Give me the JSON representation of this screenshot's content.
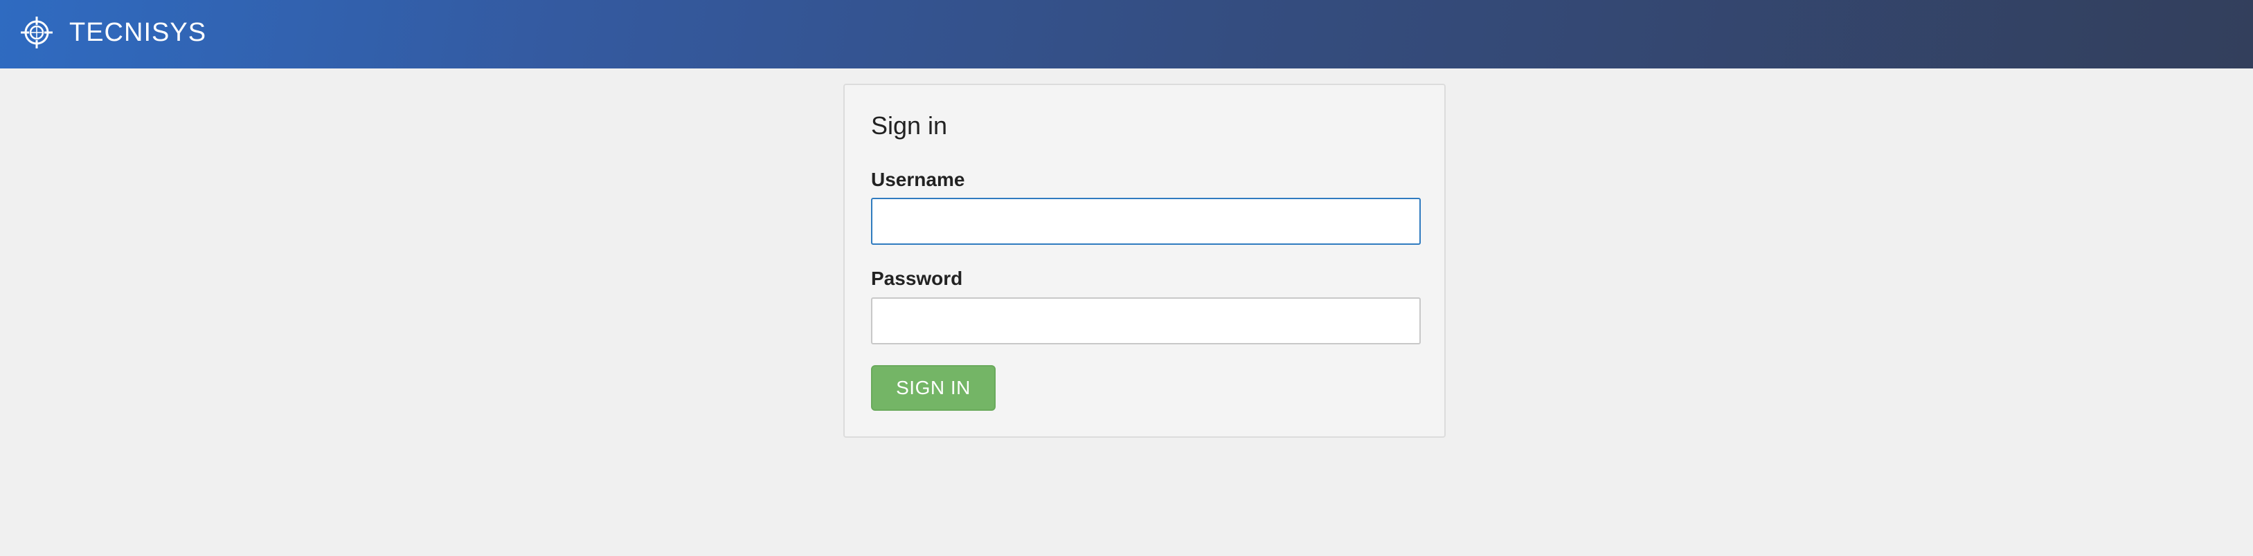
{
  "header": {
    "brand": "TECNISYS",
    "logo_icon": "globe-crosshair-icon",
    "gradient_start": "#2f6bc1",
    "gradient_end": "#333f5c"
  },
  "signin": {
    "title": "Sign in",
    "username_label": "Username",
    "username_value": "",
    "password_label": "Password",
    "password_value": "",
    "submit_label": "SIGN IN",
    "accent_color": "#74b566"
  }
}
